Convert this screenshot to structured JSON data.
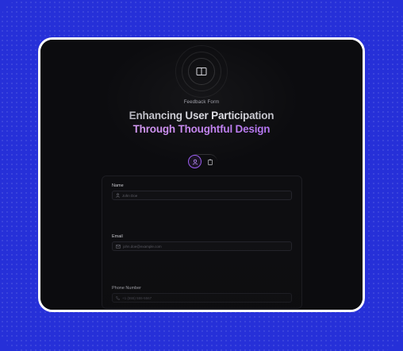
{
  "form": {
    "eyebrow": "Feedback Form",
    "title_line1": "Enhancing User Participation",
    "title_line2": "Through Thoughtful Design",
    "fields": [
      {
        "label": "Name",
        "placeholder": "John Doe",
        "icon": "user-icon"
      },
      {
        "label": "Email",
        "placeholder": "john.doe@example.com",
        "icon": "mail-icon"
      },
      {
        "label": "Phone Number",
        "placeholder": "+1 (555) 555-5567",
        "icon": "phone-icon"
      }
    ]
  },
  "icons": {
    "header": "book-icon",
    "toggle_active": "user-icon",
    "toggle_inactive": "clipboard-icon"
  },
  "colors": {
    "outer_background": "#2630d8",
    "frame_border": "#ffffff",
    "screen_background": "#0c0c0f",
    "accent_purple": "#9a5cf0",
    "accent_pink": "#e6b6f5"
  }
}
